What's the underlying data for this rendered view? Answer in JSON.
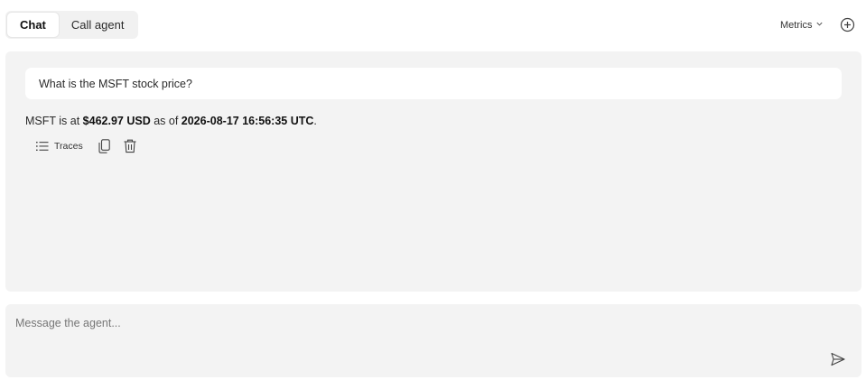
{
  "tabs": [
    {
      "label": "Chat",
      "active": true
    },
    {
      "label": "Call agent",
      "active": false
    }
  ],
  "header": {
    "metrics_label": "Metrics",
    "icons": {
      "metrics_dropdown": "chevron-down-icon",
      "add": "plus-circle-icon"
    }
  },
  "conversation": {
    "user_message": "What is the MSFT stock price?",
    "assistant_message": {
      "prefix": "MSFT is at ",
      "price": "$462.97 USD",
      "middle": " as of ",
      "timestamp": "2026-08-17 16:56:35 UTC",
      "suffix": "."
    },
    "actions": {
      "traces_label": "Traces",
      "icons": {
        "traces": "list-icon",
        "copy": "copy-icon",
        "delete": "trash-icon"
      }
    }
  },
  "composer": {
    "placeholder": "Message the agent...",
    "value": "",
    "icons": {
      "send": "send-icon"
    }
  },
  "colors": {
    "panel_bg": "#f3f3f3",
    "tab_bar_bg": "#f1f1f1",
    "message_bg": "#ffffff",
    "text": "#2a2a2a"
  }
}
